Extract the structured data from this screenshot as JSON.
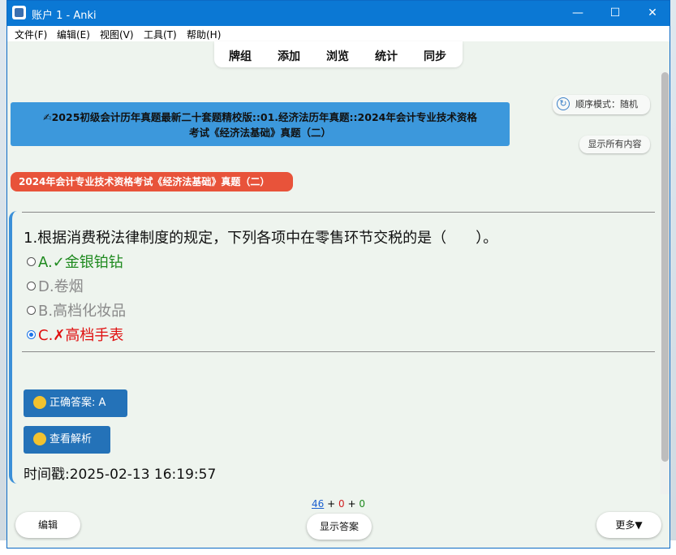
{
  "window": {
    "title": "账户 1 - Anki",
    "minimize": "—",
    "maximize": "☐",
    "close": "✕"
  },
  "menu": [
    "文件(F)",
    "编辑(E)",
    "视图(V)",
    "工具(T)",
    "帮助(H)"
  ],
  "toolbar": [
    "牌组",
    "添加",
    "浏览",
    "统计",
    "同步"
  ],
  "deck": {
    "line1": "✍2025初级会计历年真题最新二十套题精校版::01.经济法历年真题::2024年会计专业技术资格",
    "line2": "考试《经济法基础》真题（二）"
  },
  "order_mode": "顺序模式：随机",
  "show_all": "显示所有内容",
  "tag": "2024年会计专业技术资格考试《经济法基础》真题（二）",
  "question": "1.根据消费税法律制度的规定，下列各项中在零售环节交税的是（　　）。",
  "options": [
    {
      "label": "A.✓金银铂钻",
      "color": "#1f8a1f",
      "checked": false
    },
    {
      "label": "D.卷烟",
      "color": "#8a8a8a",
      "checked": false
    },
    {
      "label": "B.高档化妆品",
      "color": "#8a8a8a",
      "checked": false
    },
    {
      "label": "C.✗高档手表",
      "color": "#e01010",
      "checked": true
    }
  ],
  "correct_answer_btn": "正确答案: A",
  "explanation_btn": "查看解析",
  "timestamp": "时间戳:2025-02-13 16:19:57",
  "counts": {
    "new": "46",
    "plus1": "+",
    "learn": "0",
    "plus2": "+",
    "review": "0"
  },
  "bottom": {
    "edit": "编辑",
    "show_answer": "显示答案",
    "more": "更多▼"
  },
  "colors": {
    "accent_blue": "#3c98dc",
    "tag_red": "#e8533a",
    "button_blue": "#2472b8"
  }
}
